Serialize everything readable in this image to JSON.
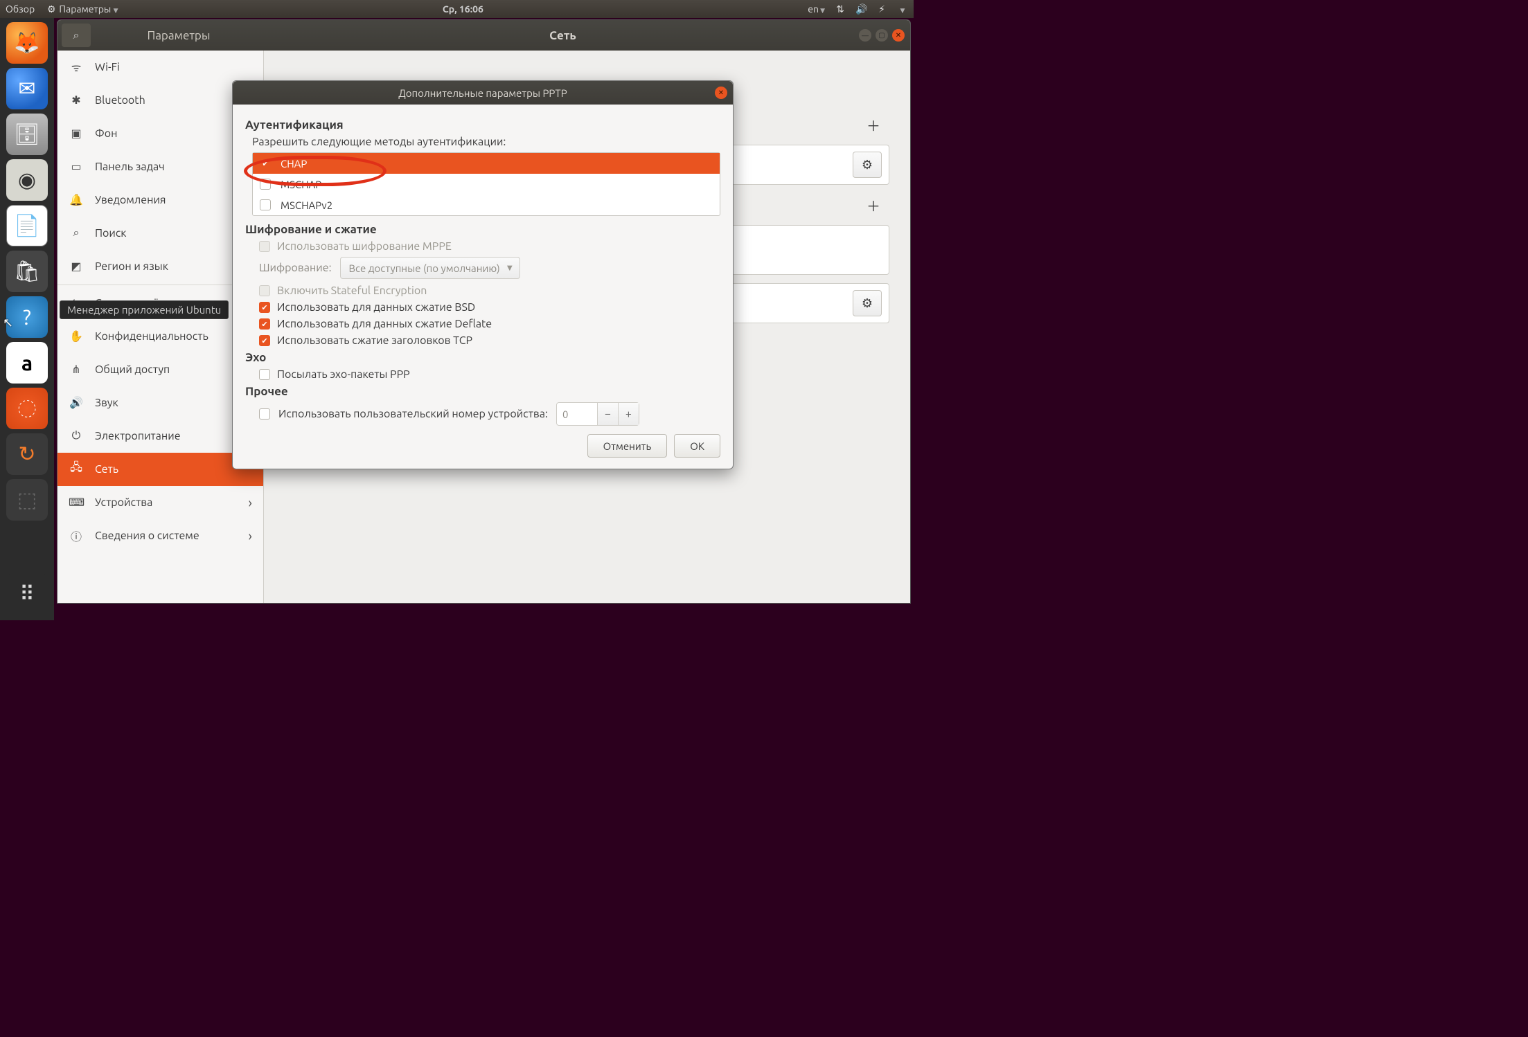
{
  "top": {
    "overview": "Обзор",
    "params": "Параметры",
    "clock": "Ср, 16:06",
    "lang": "en"
  },
  "tooltip": "Менеджер приложений Ubuntu",
  "window": {
    "search_icon": "⌕",
    "left_title": "Параметры",
    "center_title": "Сеть"
  },
  "sidebar": {
    "items": [
      {
        "icon": "ᯤ",
        "label": "Wi-Fi"
      },
      {
        "icon": "✱",
        "label": "Bluetooth"
      },
      {
        "icon": "▣",
        "label": "Фон"
      },
      {
        "icon": "▭",
        "label": "Панель задач"
      },
      {
        "icon": "🔔",
        "label": "Уведомления"
      },
      {
        "icon": "⌕",
        "label": "Поиск"
      },
      {
        "icon": "◩",
        "label": "Регион и язык"
      },
      {
        "icon": "⋮",
        "label": ""
      },
      {
        "icon": "⇆",
        "label": "Сетевые учётные записи"
      },
      {
        "icon": "✋",
        "label": "Конфиденциальность"
      },
      {
        "icon": "⋔",
        "label": "Общий доступ"
      },
      {
        "icon": "🔊",
        "label": "Звук"
      },
      {
        "icon": "⏻",
        "label": "Электропитание"
      },
      {
        "icon": "🖧",
        "label": "Сеть"
      },
      {
        "icon": "⌨",
        "label": "Устройства"
      },
      {
        "icon": "ⓘ",
        "label": "Сведения о системе"
      }
    ]
  },
  "dialog": {
    "title": "Дополнительные параметры PPTP",
    "auth_head": "Аутентификация",
    "auth_sub": "Разрешить следующие методы аутентификации:",
    "methods": [
      {
        "label": "CHAP",
        "checked": true,
        "selected": true
      },
      {
        "label": "MSCHAP",
        "checked": false,
        "selected": false
      },
      {
        "label": "MSCHAPv2",
        "checked": false,
        "selected": false
      }
    ],
    "enc_head": "Шифрование и сжатие",
    "use_mppe": "Использовать шифрование MPPE",
    "enc_label": "Шифрование:",
    "enc_combo": "Все доступные (по умолчанию)",
    "stateful": "Включить Stateful Encryption",
    "bsd": "Использовать для данных сжатие BSD",
    "deflate": "Использовать для данных сжатие Deflate",
    "tcphdr": "Использовать сжатие заголовков TCP",
    "echo_head": "Эхо",
    "echo_opt": "Посылать эхо-пакеты PPP",
    "misc_head": "Прочее",
    "unit_opt": "Использовать пользовательский номер устройства:",
    "unit_val": "0",
    "cancel": "Отменить",
    "ok": "ОК"
  }
}
